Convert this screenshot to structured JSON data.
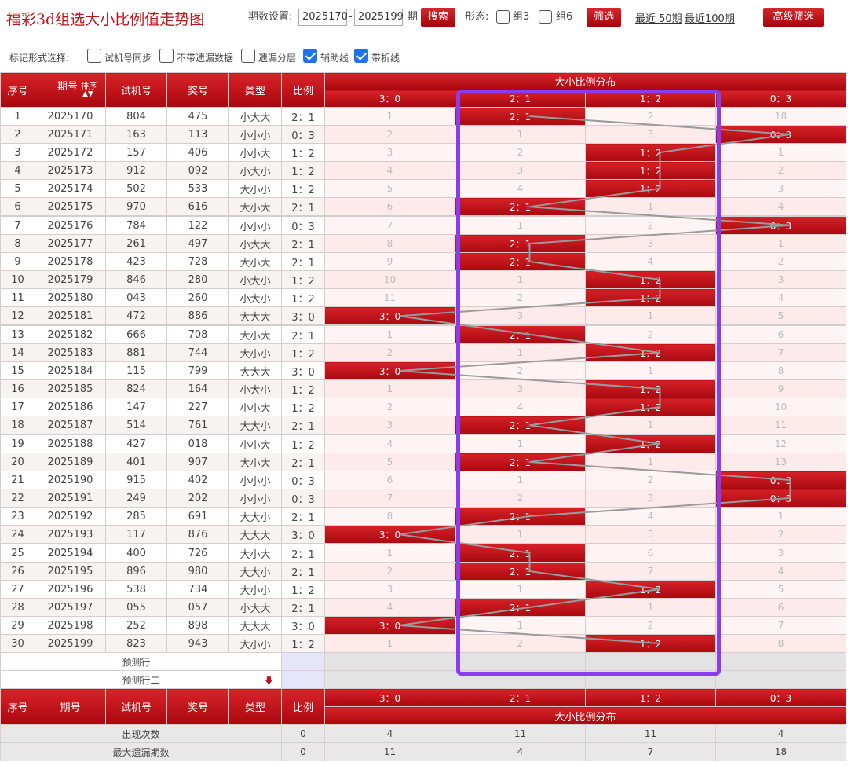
{
  "header": {
    "title": "福彩3d组选大小比例值走势图",
    "period_label": "期数设置:",
    "period_from": "2025170",
    "period_sep": "-",
    "period_to": "2025199",
    "period_unit": "期",
    "search_label": "搜索",
    "form_label": "形态:",
    "group3_label": "组3",
    "group6_label": "组6",
    "filter_label": "筛选",
    "recent50_label": "最近 50期",
    "recent100_label": "最近100期",
    "advanced_label": "高级筛选"
  },
  "options": {
    "label": "标记形式选择:",
    "items": [
      {
        "label": "试机号同步",
        "checked": false
      },
      {
        "label": "不带遗漏数据",
        "checked": false
      },
      {
        "label": "遗漏分层",
        "checked": false
      },
      {
        "label": "辅助线",
        "checked": true
      },
      {
        "label": "带折线",
        "checked": true
      }
    ]
  },
  "table": {
    "col_seq": "序号",
    "col_period": "期号",
    "col_sort": "排序",
    "col_trial": "试机号",
    "col_prize": "奖号",
    "col_type": "类型",
    "col_ratio": "比例",
    "dist_title": "大小比例分布",
    "dist_cols": [
      "3：0",
      "2：1",
      "1：2",
      "0：3"
    ],
    "rows": [
      {
        "seq": "1",
        "period": "2025170",
        "trial": "804",
        "prize": "475",
        "type": "小大大",
        "ratio": "2：1",
        "dist": [
          "1",
          "2：1",
          "2",
          "18"
        ],
        "hit": 1
      },
      {
        "seq": "2",
        "period": "2025171",
        "trial": "163",
        "prize": "113",
        "type": "小小小",
        "ratio": "0：3",
        "dist": [
          "2",
          "1",
          "3",
          "0：3"
        ],
        "hit": 3
      },
      {
        "seq": "3",
        "period": "2025172",
        "trial": "157",
        "prize": "406",
        "type": "小小大",
        "ratio": "1：2",
        "dist": [
          "3",
          "2",
          "1：2",
          "1"
        ],
        "hit": 2
      },
      {
        "seq": "4",
        "period": "2025173",
        "trial": "912",
        "prize": "092",
        "type": "小大小",
        "ratio": "1：2",
        "dist": [
          "4",
          "3",
          "1：2",
          "2"
        ],
        "hit": 2
      },
      {
        "seq": "5",
        "period": "2025174",
        "trial": "502",
        "prize": "533",
        "type": "大小小",
        "ratio": "1：2",
        "dist": [
          "5",
          "4",
          "1：2",
          "3"
        ],
        "hit": 2
      },
      {
        "seq": "6",
        "period": "2025175",
        "trial": "970",
        "prize": "616",
        "type": "大小大",
        "ratio": "2：1",
        "dist": [
          "6",
          "2：1",
          "1",
          "4"
        ],
        "hit": 1
      },
      {
        "seq": "7",
        "period": "2025176",
        "trial": "784",
        "prize": "122",
        "type": "小小小",
        "ratio": "0：3",
        "dist": [
          "7",
          "1",
          "2",
          "0：3"
        ],
        "hit": 3
      },
      {
        "seq": "8",
        "period": "2025177",
        "trial": "261",
        "prize": "497",
        "type": "小大大",
        "ratio": "2：1",
        "dist": [
          "8",
          "2：1",
          "3",
          "1"
        ],
        "hit": 1
      },
      {
        "seq": "9",
        "period": "2025178",
        "trial": "423",
        "prize": "728",
        "type": "大小大",
        "ratio": "2：1",
        "dist": [
          "9",
          "2：1",
          "4",
          "2"
        ],
        "hit": 1
      },
      {
        "seq": "10",
        "period": "2025179",
        "trial": "846",
        "prize": "280",
        "type": "小大小",
        "ratio": "1：2",
        "dist": [
          "10",
          "1",
          "1：2",
          "3"
        ],
        "hit": 2
      },
      {
        "seq": "11",
        "period": "2025180",
        "trial": "043",
        "prize": "260",
        "type": "小大小",
        "ratio": "1：2",
        "dist": [
          "11",
          "2",
          "1：2",
          "4"
        ],
        "hit": 2
      },
      {
        "seq": "12",
        "period": "2025181",
        "trial": "472",
        "prize": "886",
        "type": "大大大",
        "ratio": "3：0",
        "dist": [
          "3：0",
          "3",
          "1",
          "5"
        ],
        "hit": 0
      },
      {
        "seq": "13",
        "period": "2025182",
        "trial": "666",
        "prize": "708",
        "type": "大小大",
        "ratio": "2：1",
        "dist": [
          "1",
          "2：1",
          "2",
          "6"
        ],
        "hit": 1
      },
      {
        "seq": "14",
        "period": "2025183",
        "trial": "881",
        "prize": "744",
        "type": "大小小",
        "ratio": "1：2",
        "dist": [
          "2",
          "1",
          "1：2",
          "7"
        ],
        "hit": 2
      },
      {
        "seq": "15",
        "period": "2025184",
        "trial": "115",
        "prize": "799",
        "type": "大大大",
        "ratio": "3：0",
        "dist": [
          "3：0",
          "2",
          "1",
          "8"
        ],
        "hit": 0
      },
      {
        "seq": "16",
        "period": "2025185",
        "trial": "824",
        "prize": "164",
        "type": "小大小",
        "ratio": "1：2",
        "dist": [
          "1",
          "3",
          "1：2",
          "9"
        ],
        "hit": 2
      },
      {
        "seq": "17",
        "period": "2025186",
        "trial": "147",
        "prize": "227",
        "type": "小小大",
        "ratio": "1：2",
        "dist": [
          "2",
          "4",
          "1：2",
          "10"
        ],
        "hit": 2
      },
      {
        "seq": "18",
        "period": "2025187",
        "trial": "514",
        "prize": "761",
        "type": "大大小",
        "ratio": "2：1",
        "dist": [
          "3",
          "2：1",
          "1",
          "11"
        ],
        "hit": 1
      },
      {
        "seq": "19",
        "period": "2025188",
        "trial": "427",
        "prize": "018",
        "type": "小小大",
        "ratio": "1：2",
        "dist": [
          "4",
          "1",
          "1：2",
          "12"
        ],
        "hit": 2
      },
      {
        "seq": "20",
        "period": "2025189",
        "trial": "401",
        "prize": "907",
        "type": "大小大",
        "ratio": "2：1",
        "dist": [
          "5",
          "2：1",
          "1",
          "13"
        ],
        "hit": 1
      },
      {
        "seq": "21",
        "period": "2025190",
        "trial": "915",
        "prize": "402",
        "type": "小小小",
        "ratio": "0：3",
        "dist": [
          "6",
          "1",
          "2",
          "0：3"
        ],
        "hit": 3
      },
      {
        "seq": "22",
        "period": "2025191",
        "trial": "249",
        "prize": "202",
        "type": "小小小",
        "ratio": "0：3",
        "dist": [
          "7",
          "2",
          "3",
          "0：3"
        ],
        "hit": 3
      },
      {
        "seq": "23",
        "period": "2025192",
        "trial": "285",
        "prize": "691",
        "type": "大大小",
        "ratio": "2：1",
        "dist": [
          "8",
          "2：1",
          "4",
          "1"
        ],
        "hit": 1
      },
      {
        "seq": "24",
        "period": "2025193",
        "trial": "117",
        "prize": "876",
        "type": "大大大",
        "ratio": "3：0",
        "dist": [
          "3：0",
          "1",
          "5",
          "2"
        ],
        "hit": 0
      },
      {
        "seq": "25",
        "period": "2025194",
        "trial": "400",
        "prize": "726",
        "type": "大小大",
        "ratio": "2：1",
        "dist": [
          "1",
          "2：1",
          "6",
          "3"
        ],
        "hit": 1
      },
      {
        "seq": "26",
        "period": "2025195",
        "trial": "896",
        "prize": "980",
        "type": "大大小",
        "ratio": "2：1",
        "dist": [
          "2",
          "2：1",
          "7",
          "4"
        ],
        "hit": 1
      },
      {
        "seq": "27",
        "period": "2025196",
        "trial": "538",
        "prize": "734",
        "type": "大小小",
        "ratio": "1：2",
        "dist": [
          "3",
          "1",
          "1：2",
          "5"
        ],
        "hit": 2
      },
      {
        "seq": "28",
        "period": "2025197",
        "trial": "055",
        "prize": "057",
        "type": "小大大",
        "ratio": "2：1",
        "dist": [
          "4",
          "2：1",
          "1",
          "6"
        ],
        "hit": 1
      },
      {
        "seq": "29",
        "period": "2025198",
        "trial": "252",
        "prize": "898",
        "type": "大大大",
        "ratio": "3：0",
        "dist": [
          "3：0",
          "1",
          "2",
          "7"
        ],
        "hit": 0
      },
      {
        "seq": "30",
        "period": "2025199",
        "trial": "823",
        "prize": "943",
        "type": "大小小",
        "ratio": "1：2",
        "dist": [
          "1",
          "2",
          "1：2",
          "8"
        ],
        "hit": 2
      }
    ],
    "predict1": "预测行一",
    "predict2": "预测行二",
    "summary": [
      {
        "label": "出现次数",
        "type": "0",
        "ratio": "0",
        "dist": [
          "4",
          "11",
          "11",
          "4"
        ]
      },
      {
        "label": "最大遗漏期数",
        "type": "0",
        "ratio": "0",
        "dist": [
          "11",
          "4",
          "7",
          "18"
        ]
      }
    ]
  },
  "colors": {
    "accent": "#c0141b",
    "highlight": "#8b3cf0"
  }
}
